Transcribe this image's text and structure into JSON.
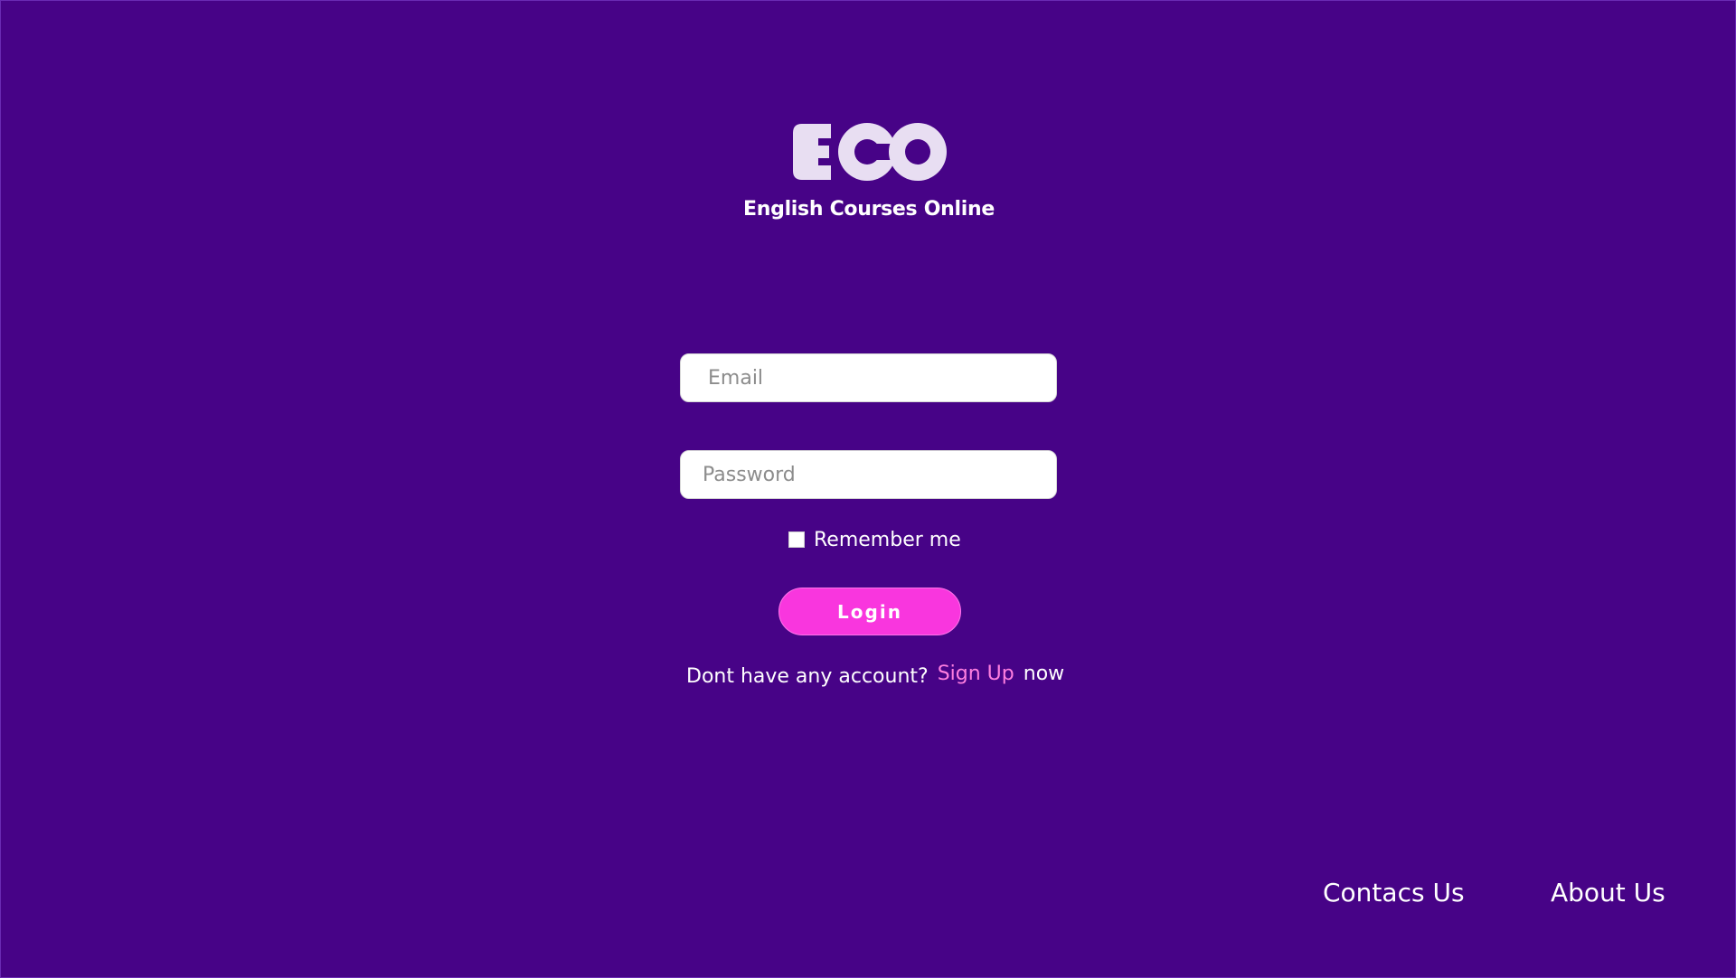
{
  "brand": {
    "logo_text": "ECO",
    "tagline": "English Courses Online",
    "logo_color": "#e8def2"
  },
  "colors": {
    "background": "#470387",
    "accent": "#f936de",
    "link": "#ff7fe0"
  },
  "form": {
    "email_placeholder": "Email",
    "password_placeholder": "Password",
    "remember_label": "Remember me",
    "login_label": "Login"
  },
  "signup": {
    "prompt": "Dont have any account?",
    "link_label": "Sign Up",
    "suffix": "now"
  },
  "footer": {
    "contact_label": "Contacs Us",
    "about_label": "About Us"
  }
}
